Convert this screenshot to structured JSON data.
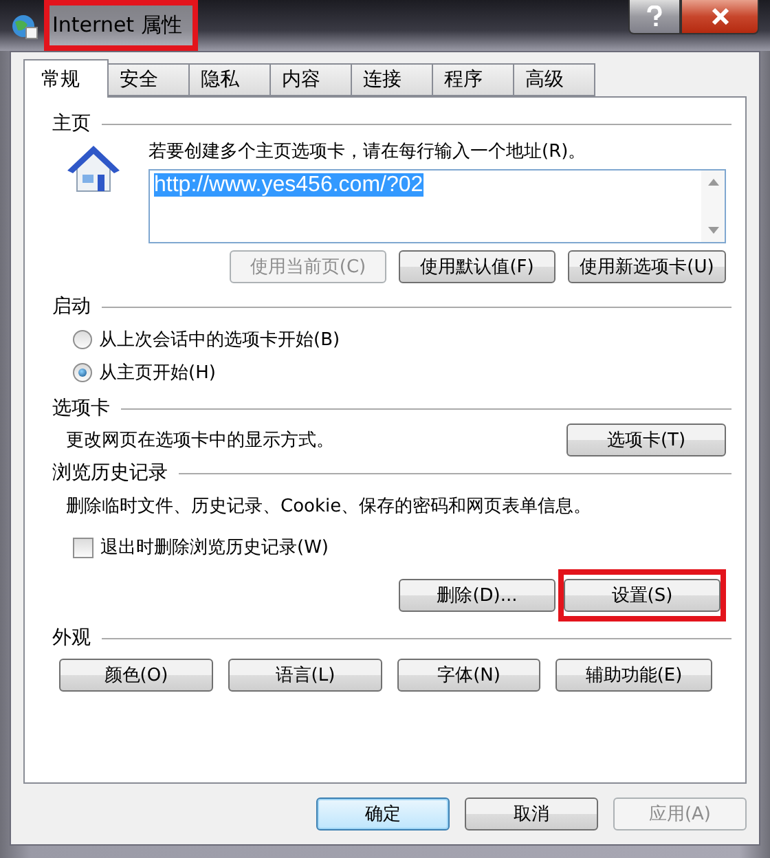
{
  "window": {
    "title": "Internet 属性",
    "title_highlighted": true
  },
  "tabs": [
    {
      "label": "常规",
      "selected": true
    },
    {
      "label": "安全",
      "selected": false
    },
    {
      "label": "隐私",
      "selected": false
    },
    {
      "label": "内容",
      "selected": false
    },
    {
      "label": "连接",
      "selected": false
    },
    {
      "label": "程序",
      "selected": false
    },
    {
      "label": "高级",
      "selected": false
    }
  ],
  "homepage": {
    "heading": "主页",
    "instruction": "若要创建多个主页选项卡，请在每行输入一个地址(R)。",
    "url": "http://www.yes456.com/?02",
    "url_selected": true,
    "buttons": [
      {
        "label": "使用当前页(C)",
        "disabled": true
      },
      {
        "label": "使用默认值(F)",
        "disabled": false
      },
      {
        "label": "使用新选项卡(U)",
        "disabled": false
      }
    ]
  },
  "startup": {
    "heading": "启动",
    "options": [
      {
        "label": "从上次会话中的选项卡开始(B)",
        "selected": false
      },
      {
        "label": "从主页开始(H)",
        "selected": true
      }
    ]
  },
  "tab_settings": {
    "heading": "选项卡",
    "description": "更改网页在选项卡中的显示方式。",
    "button": "选项卡(T)"
  },
  "history": {
    "heading": "浏览历史记录",
    "description": "删除临时文件、历史记录、Cookie、保存的密码和网页表单信息。",
    "checkbox": {
      "label": "退出时删除浏览历史记录(W)",
      "checked": false
    },
    "buttons": [
      {
        "label": "删除(D)...",
        "highlighted": false
      },
      {
        "label": "设置(S)",
        "highlighted": true
      }
    ]
  },
  "appearance": {
    "heading": "外观",
    "buttons": [
      "颜色(O)",
      "语言(L)",
      "字体(N)",
      "辅助功能(E)"
    ]
  },
  "footer_buttons": [
    {
      "label": "确定",
      "focused": true,
      "disabled": false
    },
    {
      "label": "取消",
      "focused": false,
      "disabled": false
    },
    {
      "label": "应用(A)",
      "focused": false,
      "disabled": true
    }
  ]
}
